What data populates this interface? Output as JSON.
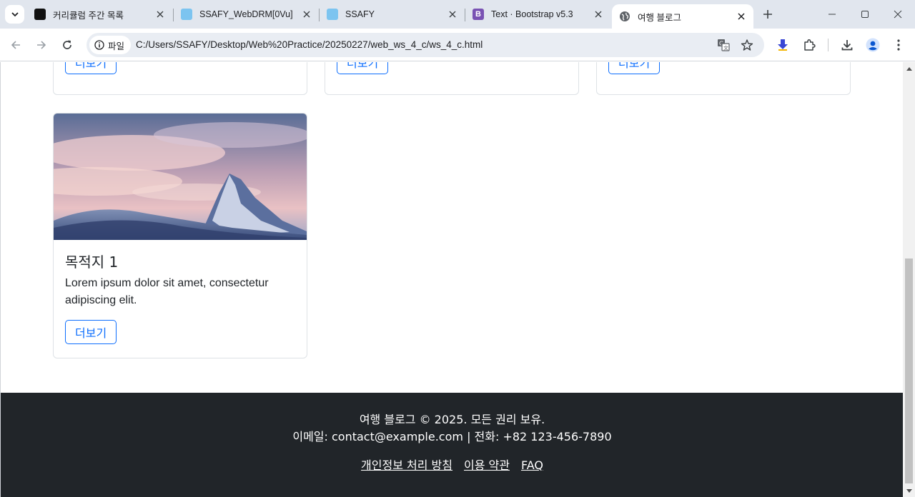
{
  "browser": {
    "tabs": [
      {
        "title": "커리큘럼 주간 목록",
        "favicon": "ssafy-notion-icon",
        "active": false
      },
      {
        "title": "SSAFY_WebDRM[0Vu]",
        "favicon": "ssafy-icon",
        "active": false
      },
      {
        "title": "SSAFY",
        "favicon": "ssafy-icon",
        "active": false
      },
      {
        "title": "Text · Bootstrap v5.3",
        "favicon": "bootstrap-icon",
        "active": false
      },
      {
        "title": "여행 블로그",
        "favicon": "globe-icon",
        "active": true
      }
    ],
    "address": {
      "chip_label": "파일",
      "url": "C:/Users/SSAFY/Desktop/Web%20Practice/20250227/web_ws_4_c/ws_4_c.html"
    },
    "colors": {
      "tabstrip": "#e1e6ee",
      "omnibox": "#e9edf3",
      "bootstrap_purple": "#7952b3"
    }
  },
  "page": {
    "cards_top": [
      {
        "button": "더보기"
      },
      {
        "button": "더보기"
      },
      {
        "button": "더보기"
      }
    ],
    "card": {
      "title": "목적지 1",
      "text": "Lorem ipsum dolor sit amet, consectetur adipiscing elit.",
      "button": "더보기",
      "image": "snowy-mountain-peak-at-sunset"
    },
    "footer": {
      "line1": "여행 블로그 © 2025. 모든 권리 보유.",
      "line2": "이메일: contact@example.com | 전화: +82 123-456-7890",
      "links": [
        "개인정보 처리 방침",
        "이용 약관",
        "FAQ"
      ]
    },
    "colors": {
      "primary": "#0d6efd",
      "footer_bg": "#212529"
    }
  }
}
